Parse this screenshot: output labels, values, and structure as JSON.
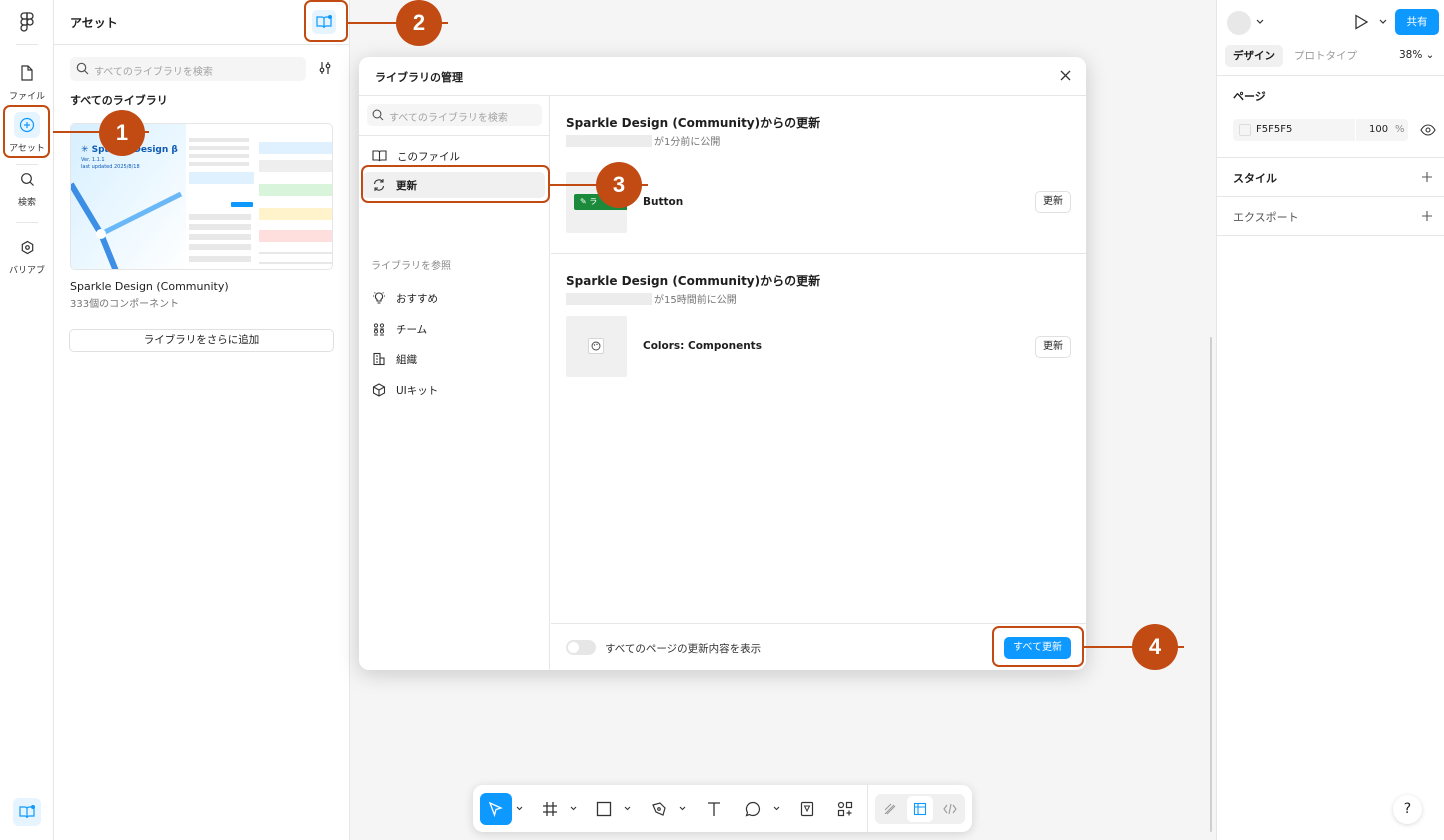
{
  "rail": {
    "items": [
      {
        "label": "ファイル",
        "icon": "file-icon"
      },
      {
        "label": "アセット",
        "icon": "plus-circle-icon"
      },
      {
        "label": "検索",
        "icon": "search-icon"
      },
      {
        "label": "バリアブ",
        "icon": "variables-icon"
      }
    ]
  },
  "assets": {
    "title": "アセット",
    "search_placeholder": "すべてのライブラリを検索",
    "section": "すべてのライブラリ",
    "library": {
      "name": "Sparkle Design (Community)",
      "count": "333個のコンポーネント"
    },
    "thumbnail": {
      "brand": "Sparkle Design",
      "version": "Ver. 1.1.1",
      "updated": "last updated 2025/8/18"
    },
    "add_button": "ライブラリをさらに追加"
  },
  "modal": {
    "title": "ライブラリの管理",
    "search_placeholder": "すべてのライブラリを検索",
    "nav_this_file": "このファイル",
    "nav_updates": "更新",
    "group_label": "ライブラリを参照",
    "nav_recommended": "おすすめ",
    "nav_team": "チーム",
    "nav_org": "組織",
    "nav_uikit": "UIキット",
    "updates": [
      {
        "title": "Sparkle Design (Community)からの更新",
        "meta": "が1分前に公開",
        "item": "Button",
        "button": "更新"
      },
      {
        "title": "Sparkle Design (Community)からの更新",
        "meta": "が15時間前に公開",
        "item": "Colors: Components",
        "button": "更新"
      }
    ],
    "toggle_label": "すべてのページの更新内容を表示",
    "update_all": "すべて更新"
  },
  "right_panel": {
    "share": "共有",
    "tab_design": "デザイン",
    "tab_prototype": "プロトタイプ",
    "zoom": "38%",
    "page_label": "ページ",
    "page_color": "F5F5F5",
    "page_opacity": "100",
    "percent": "%",
    "styles_label": "スタイル",
    "export_label": "エクスポート"
  },
  "help": "?",
  "callouts": [
    "1",
    "2",
    "3",
    "4"
  ],
  "colors": {
    "accent": "#0d99ff",
    "callout": "#c24b14"
  }
}
